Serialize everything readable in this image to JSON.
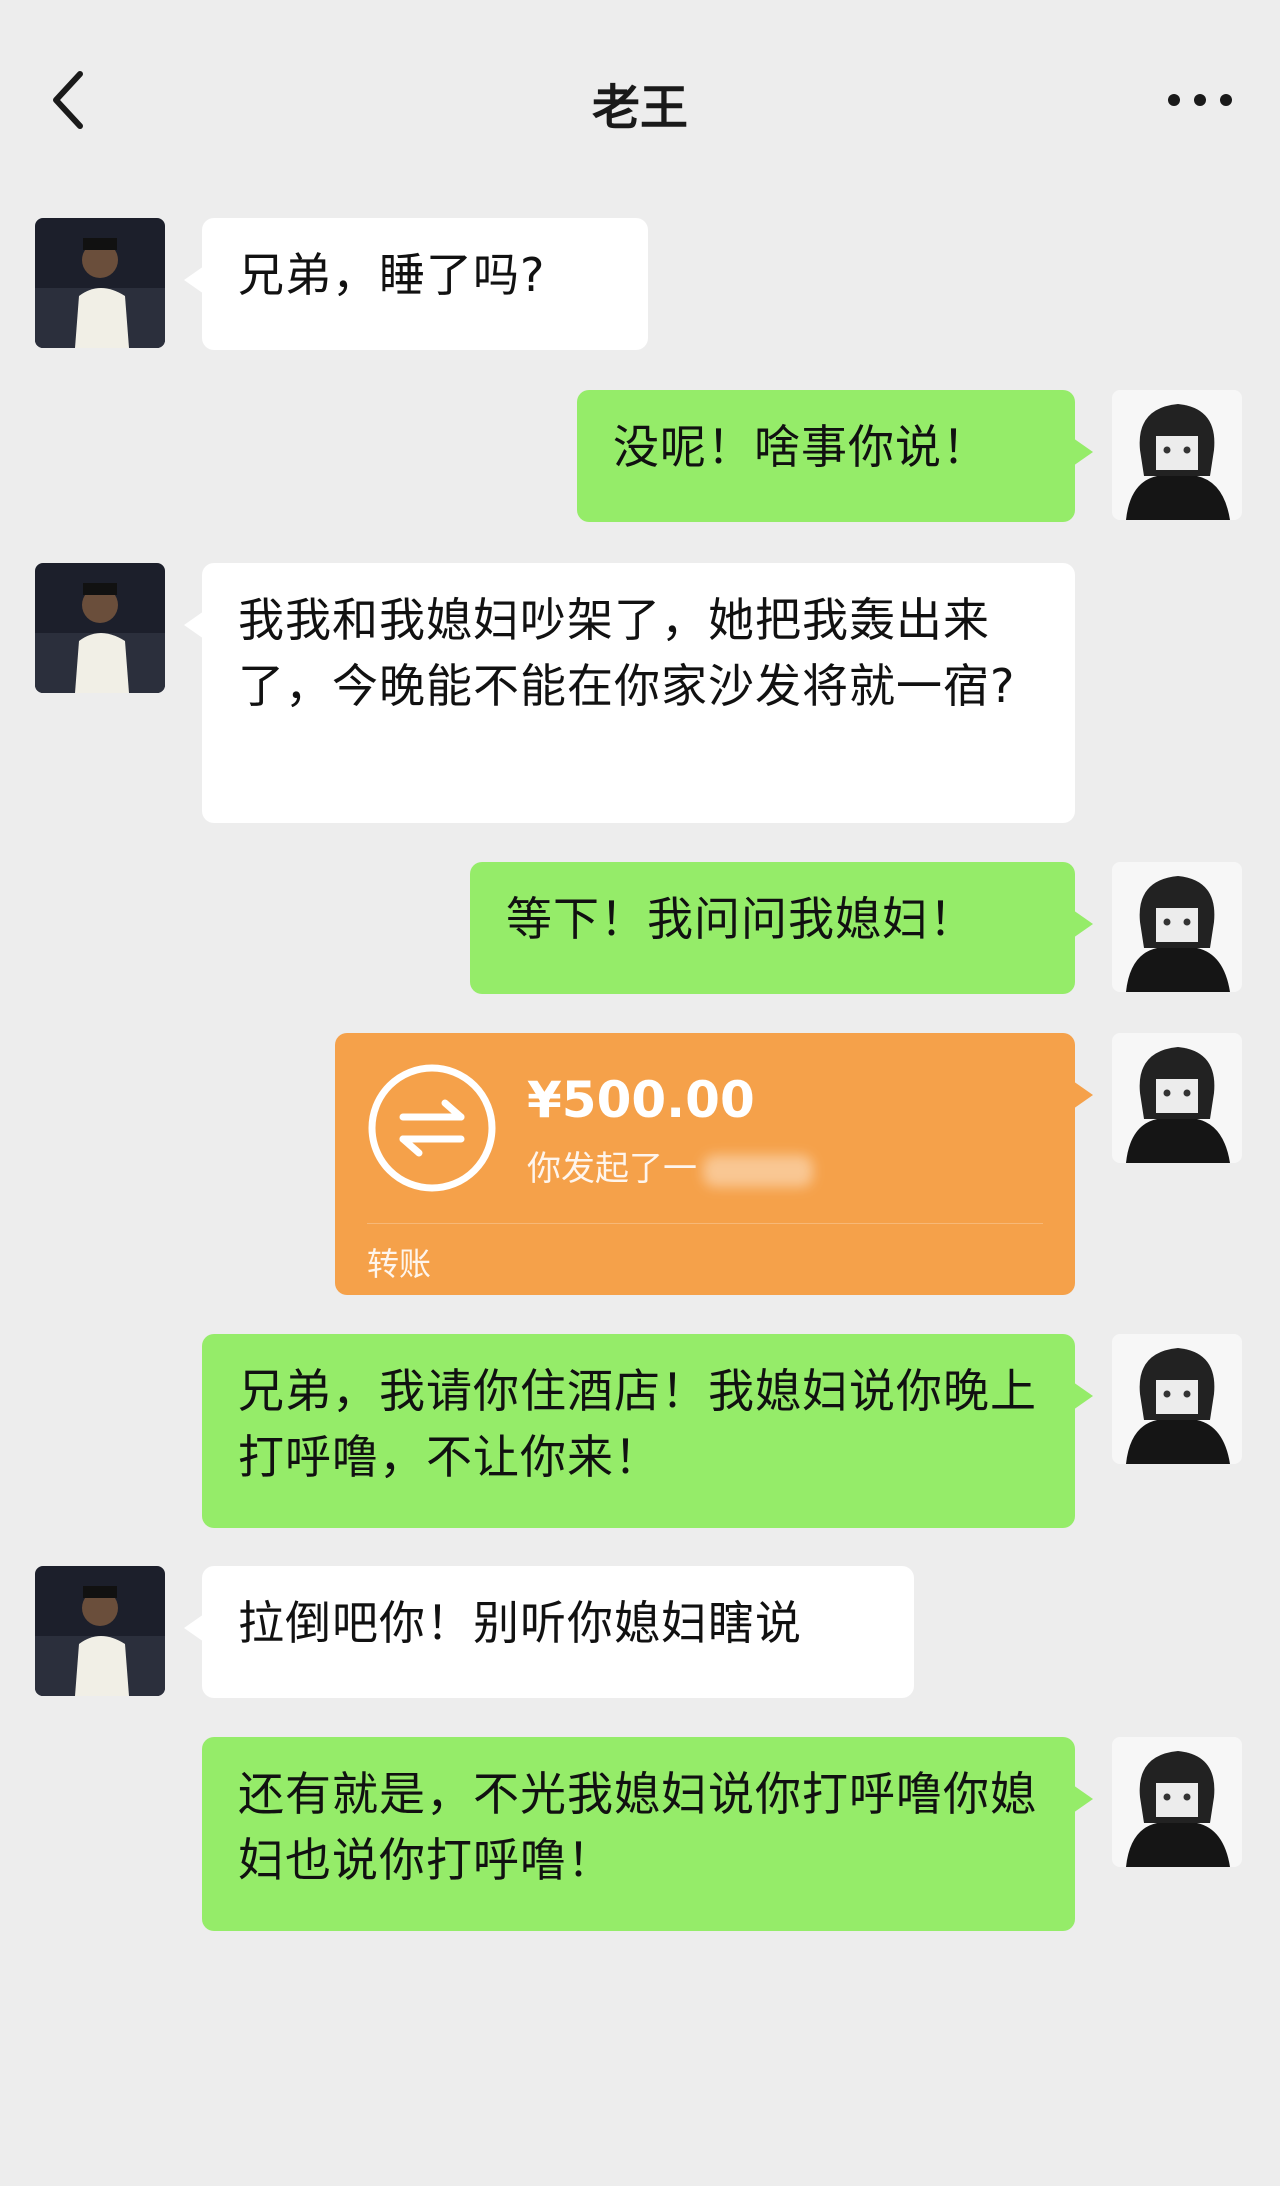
{
  "header": {
    "title": "老王",
    "back_icon": "chevron-left-icon",
    "more_icon": "more-dots-icon"
  },
  "colors": {
    "background": "#ededed",
    "incoming_bubble": "#ffffff",
    "outgoing_bubble": "#95ec69",
    "transfer_card": "#f5a14a"
  },
  "messages": [
    {
      "from": "friend",
      "text": "兄弟，睡了吗?"
    },
    {
      "from": "me",
      "text": "没呢！啥事你说！"
    },
    {
      "from": "friend",
      "text": "我我和我媳妇吵架了，她把我轰出来了，今晚能不能在你家沙发将就一宿?"
    },
    {
      "from": "me",
      "text": "等下！我问问我媳妇！"
    },
    {
      "from": "me",
      "type": "transfer",
      "amount": "¥500.00",
      "note": "你发起了一",
      "label": "转账"
    },
    {
      "from": "me",
      "text": "兄弟，我请你住酒店！我媳妇说你晚上打呼噜，不让你来！"
    },
    {
      "from": "friend",
      "text": "拉倒吧你！别听你媳妇瞎说"
    },
    {
      "from": "me",
      "text": "还有就是，不光我媳妇说你打呼噜你媳妇也说你打呼噜！"
    }
  ]
}
